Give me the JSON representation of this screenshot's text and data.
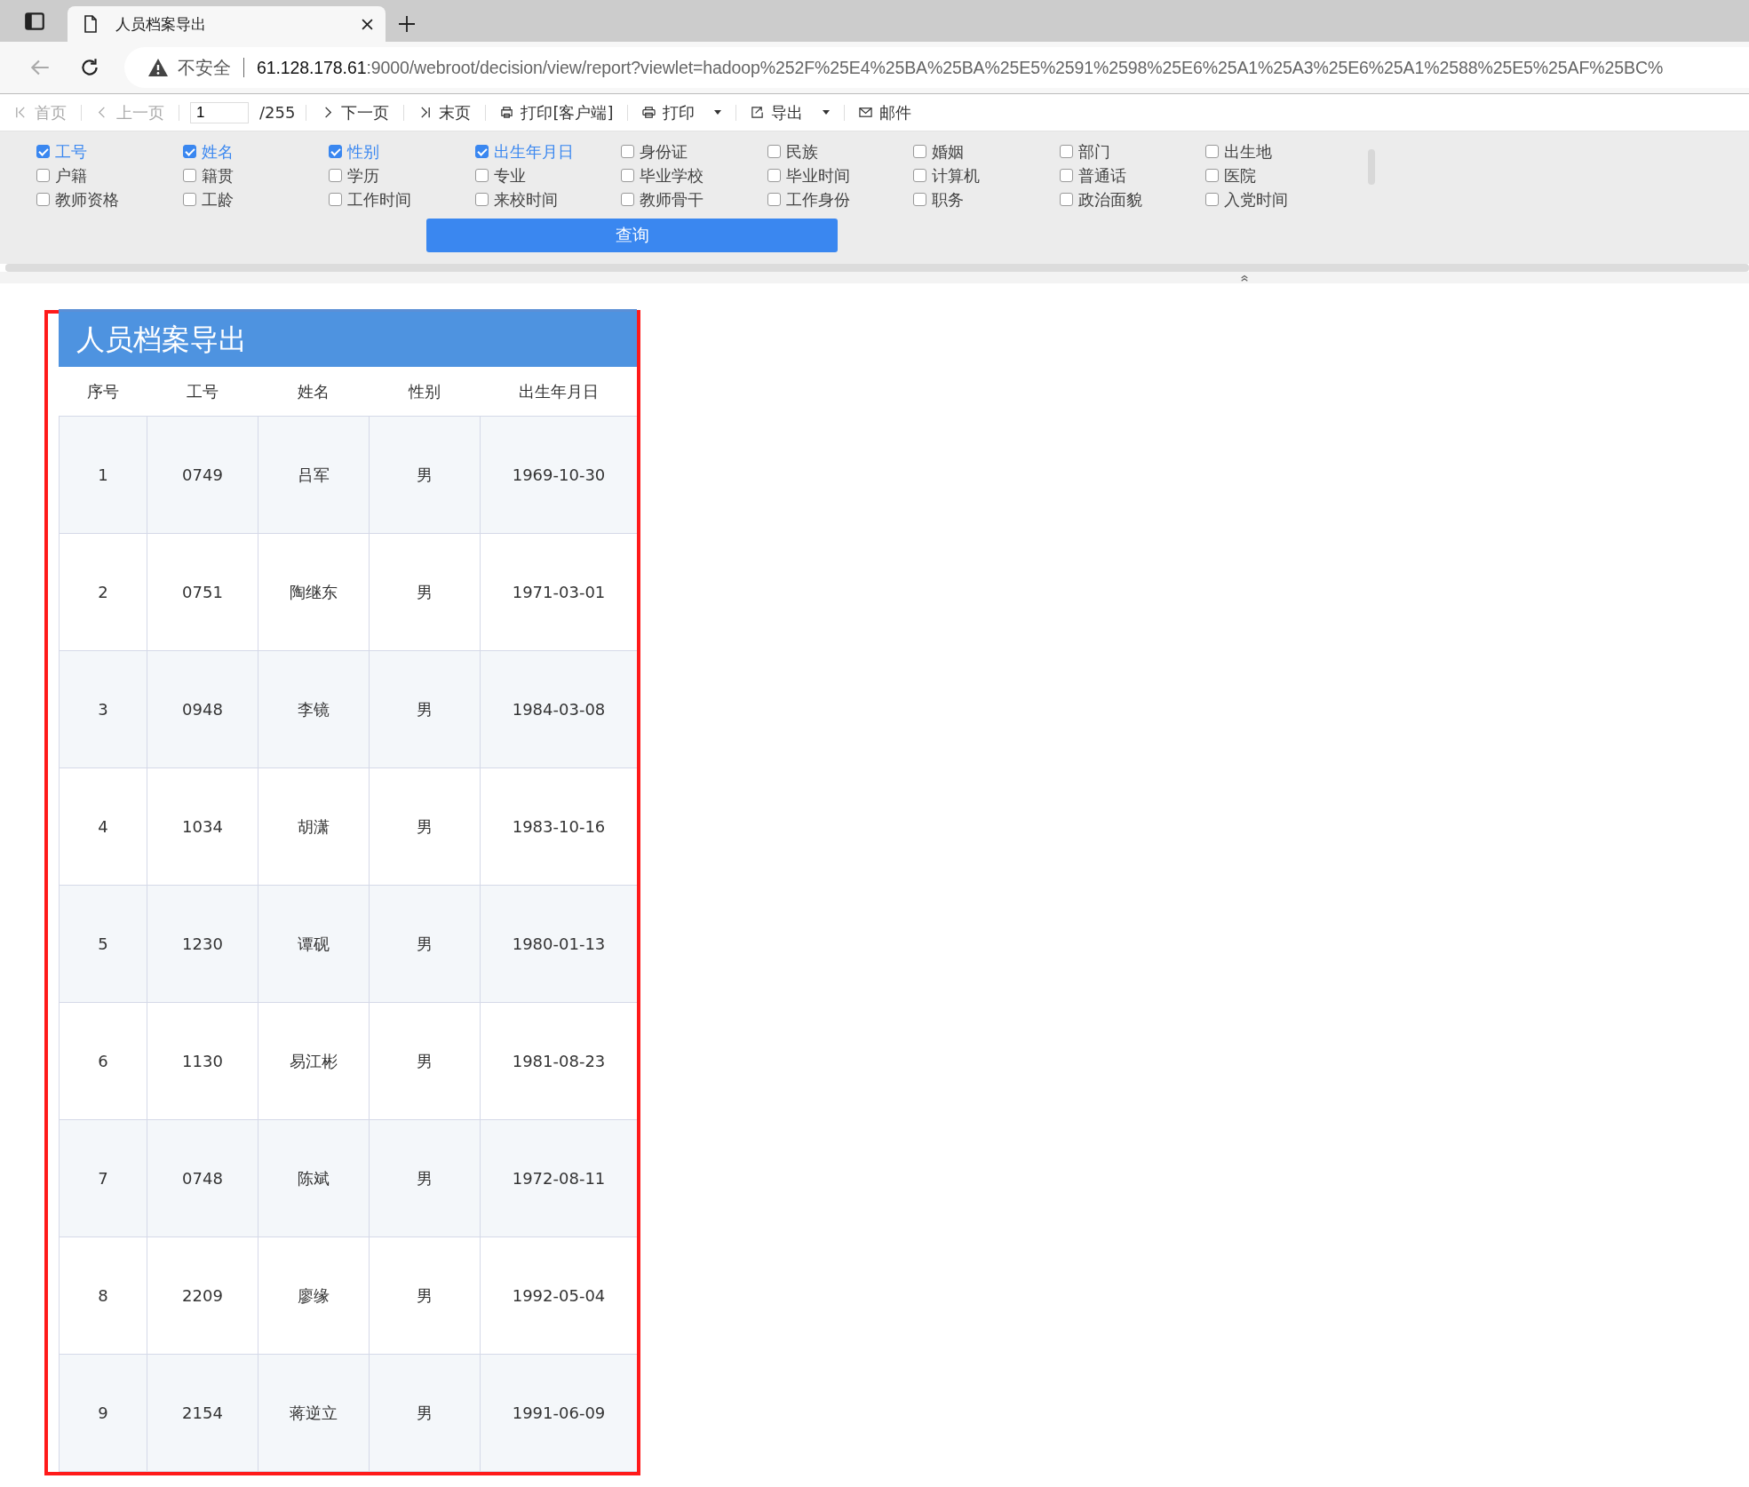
{
  "browser": {
    "tab_title": "人员档案导出",
    "security_label": "不安全",
    "url_host": "61.128.178.61",
    "url_rest": ":9000/webroot/decision/view/report?viewlet=hadoop%252F%25E4%25BA%25BA%25E5%2591%2598%25E6%25A1%25A3%25E6%25A1%2588%25E5%25AF%25BC%"
  },
  "toolbar": {
    "items": [
      {
        "kind": "button",
        "label": "首页",
        "disabled": true
      },
      {
        "kind": "button",
        "label": "上一页",
        "disabled": true
      },
      {
        "kind": "page",
        "value": "1",
        "total": "/255"
      },
      {
        "kind": "button",
        "label": "下一页",
        "disabled": false
      },
      {
        "kind": "button",
        "label": "末页",
        "disabled": false
      },
      {
        "kind": "button",
        "label": "打印[客户端]",
        "disabled": false
      },
      {
        "kind": "menu",
        "label": "打印",
        "disabled": false
      },
      {
        "kind": "menu",
        "label": "导出",
        "disabled": false
      },
      {
        "kind": "button",
        "label": "邮件",
        "disabled": false
      }
    ]
  },
  "filters": {
    "options": [
      {
        "label": "工号",
        "checked": true
      },
      {
        "label": "姓名",
        "checked": true
      },
      {
        "label": "性别",
        "checked": true
      },
      {
        "label": "出生年月日",
        "checked": true
      },
      {
        "label": "身份证",
        "checked": false
      },
      {
        "label": "民族",
        "checked": false
      },
      {
        "label": "婚姻",
        "checked": false
      },
      {
        "label": "部门",
        "checked": false
      },
      {
        "label": "出生地",
        "checked": false
      },
      {
        "label": "户籍",
        "checked": false
      },
      {
        "label": "籍贯",
        "checked": false
      },
      {
        "label": "学历",
        "checked": false
      },
      {
        "label": "专业",
        "checked": false
      },
      {
        "label": "毕业学校",
        "checked": false
      },
      {
        "label": "毕业时间",
        "checked": false
      },
      {
        "label": "计算机",
        "checked": false
      },
      {
        "label": "普通话",
        "checked": false
      },
      {
        "label": "医院",
        "checked": false
      },
      {
        "label": "教师资格",
        "checked": false
      },
      {
        "label": "工龄",
        "checked": false
      },
      {
        "label": "工作时间",
        "checked": false
      },
      {
        "label": "来校时间",
        "checked": false
      },
      {
        "label": "教师骨干",
        "checked": false
      },
      {
        "label": "工作身份",
        "checked": false
      },
      {
        "label": "职务",
        "checked": false
      },
      {
        "label": "政治面貌",
        "checked": false
      },
      {
        "label": "入党时间",
        "checked": false
      }
    ],
    "query_button": "查询"
  },
  "report": {
    "title": "人员档案导出",
    "table": {
      "columns": [
        "序号",
        "工号",
        "姓名",
        "性别",
        "出生年月日"
      ],
      "rows": [
        [
          "1",
          "0749",
          "吕军",
          "男",
          "1969-10-30"
        ],
        [
          "2",
          "0751",
          "陶继东",
          "男",
          "1971-03-01"
        ],
        [
          "3",
          "0948",
          "李镜",
          "男",
          "1984-03-08"
        ],
        [
          "4",
          "1034",
          "胡潇",
          "男",
          "1983-10-16"
        ],
        [
          "5",
          "1230",
          "谭砚",
          "男",
          "1980-01-13"
        ],
        [
          "6",
          "1130",
          "易江彬",
          "男",
          "1981-08-23"
        ],
        [
          "7",
          "0748",
          "陈斌",
          "男",
          "1972-08-11"
        ],
        [
          "8",
          "2209",
          "廖缘",
          "男",
          "1992-05-04"
        ],
        [
          "9",
          "2154",
          "蒋逆立",
          "男",
          "1991-06-09"
        ]
      ]
    }
  }
}
